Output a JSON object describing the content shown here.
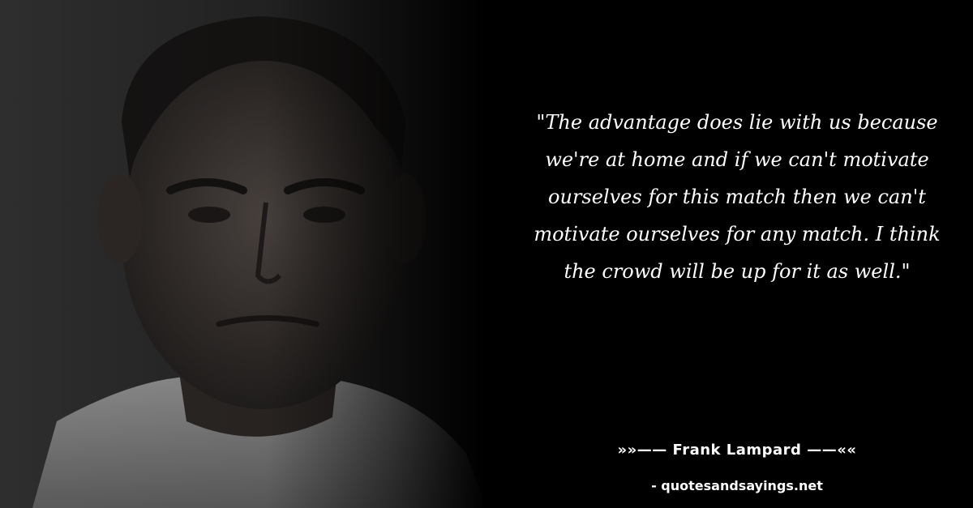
{
  "quote": {
    "text": "\"The advantage does lie with us because we're at home and if we can't motivate ourselves for this match then we can't motivate ourselves for any match. I think the crowd will be up for it as well.\""
  },
  "author": {
    "label": "»»—— Frank Lampard ——««"
  },
  "source": {
    "label": "- quotesandsayings.net"
  },
  "colors": {
    "background": "#000000",
    "text": "#ffffff"
  }
}
